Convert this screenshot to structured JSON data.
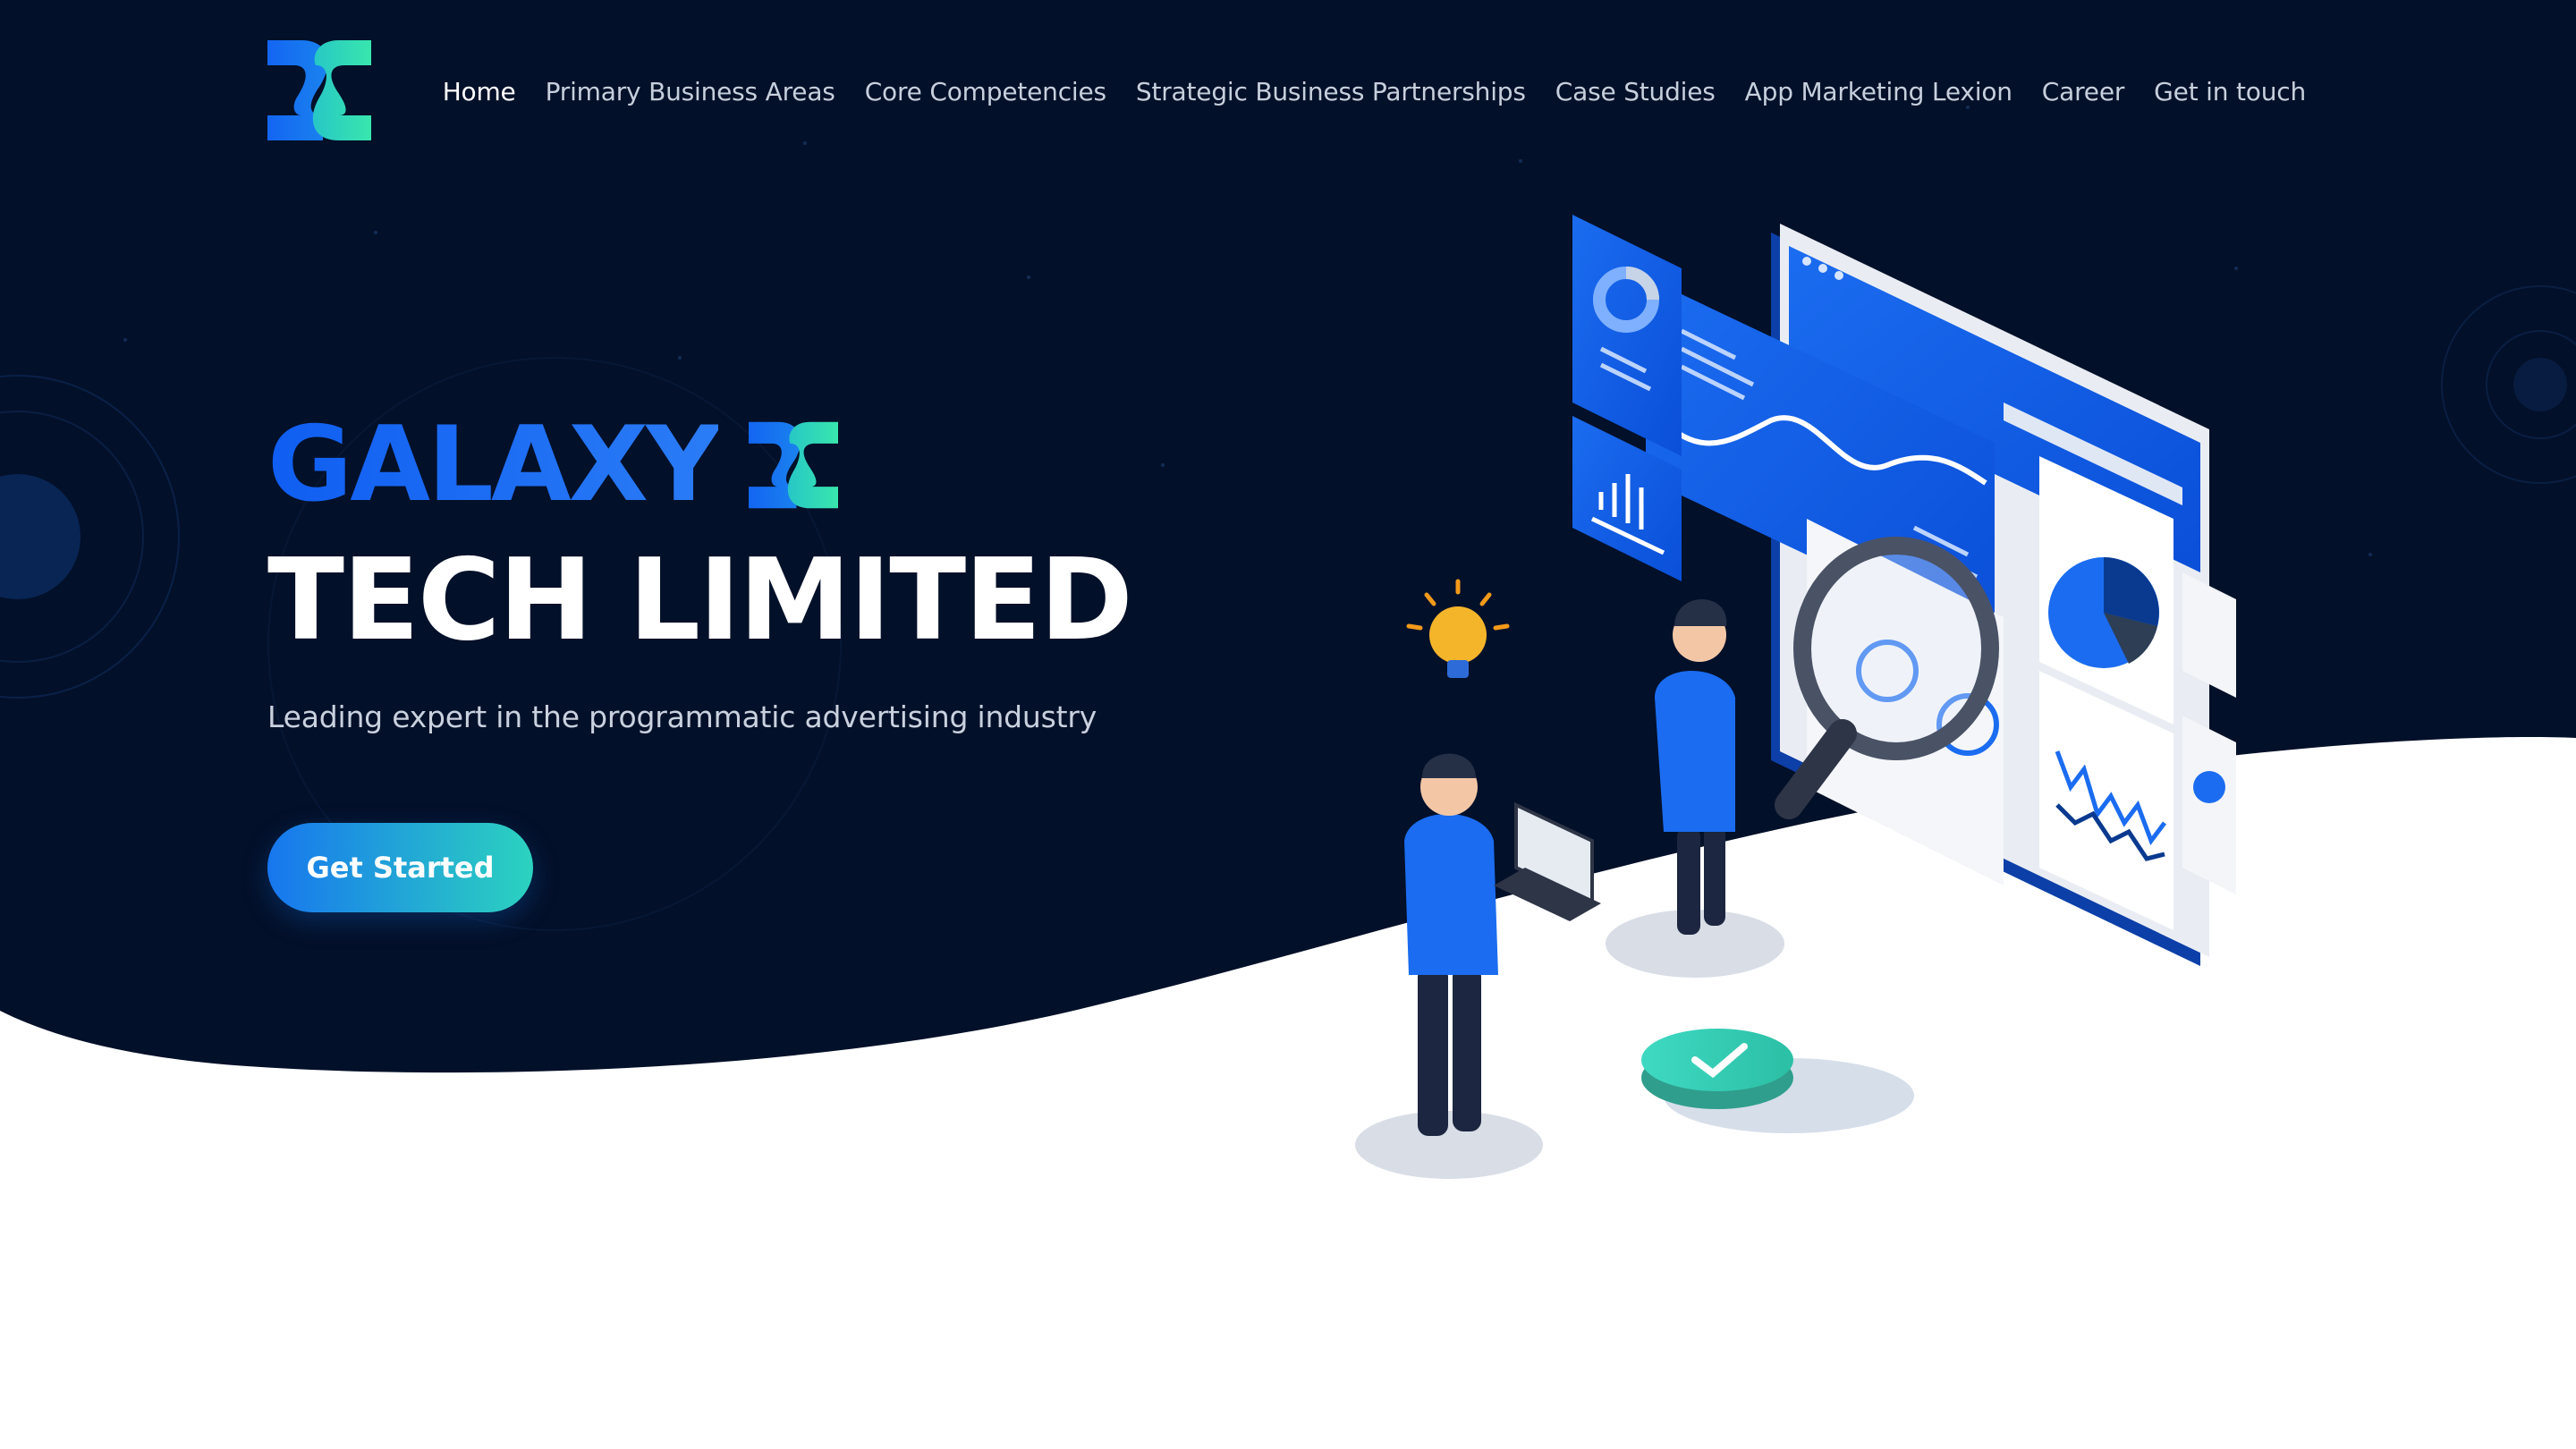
{
  "logo": {
    "icon": "dc-logo-icon"
  },
  "nav": {
    "items": [
      {
        "label": "Home",
        "active": true
      },
      {
        "label": "Primary Business Areas",
        "active": false
      },
      {
        "label": "Core Competencies",
        "active": false
      },
      {
        "label": "Strategic Business Partnerships",
        "active": false
      },
      {
        "label": "Case Studies",
        "active": false
      },
      {
        "label": "App Marketing Lexion",
        "active": false
      },
      {
        "label": "Career",
        "active": false
      },
      {
        "label": "Get in touch",
        "active": false
      }
    ]
  },
  "hero": {
    "brand_word": "GALAXY",
    "company_name": "TECH LIMITED",
    "tagline": "Leading expert in the programmatic advertising industry",
    "cta_label": "Get Started"
  },
  "colors": {
    "background": "#031029",
    "brand_blue": "#1a67f0",
    "brand_teal": "#2ee0b8",
    "cta_gradient_start": "#1776ef",
    "cta_gradient_end": "#2cd3bf",
    "white": "#ffffff"
  },
  "illustration": {
    "icons": [
      "analytics-dashboard-illustration",
      "magnifier-icon",
      "lightbulb-icon",
      "laptop-icon",
      "checkmark-icon",
      "pie-chart-icon",
      "bar-chart-icon"
    ]
  }
}
